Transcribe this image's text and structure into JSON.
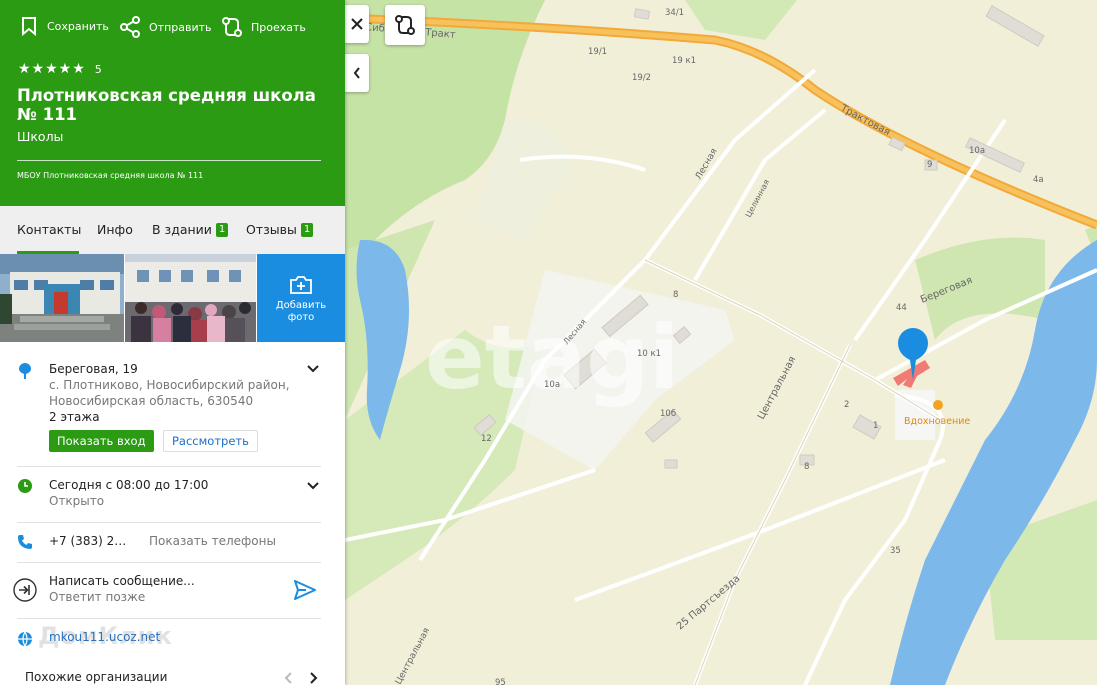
{
  "header": {
    "actions": {
      "save": "Сохранить",
      "share": "Отправить",
      "route": "Проехать"
    },
    "stars_glyphs": "★★★★★",
    "rating": "5",
    "title": "Плотниковская средняя школа № 111",
    "category": "Школы",
    "legal_name": "МБОУ Плотниковская средняя школа № 111",
    "accent_color": "#2b9b14"
  },
  "tabs": [
    {
      "label": "Контакты",
      "active": true
    },
    {
      "label": "Инфо"
    },
    {
      "label": "В здании",
      "badge": "1"
    },
    {
      "label": "Отзывы",
      "badge": "1"
    }
  ],
  "photos": {
    "add_label_1": "Добавить",
    "add_label_2": "фото"
  },
  "address": {
    "street": "Береговая, 19",
    "line2": "с. Плотниково, Новосибирский район,",
    "line3": "Новосибирская область, 630540",
    "floors": "2 этажа",
    "show_entrance": "Показать вход",
    "view": "Рассмотреть"
  },
  "hours": {
    "schedule": "Сегодня с 08:00 до 17:00",
    "status": "Открыто"
  },
  "phone": {
    "number": "+7 (383) 2…",
    "show": "Показать телефоны"
  },
  "message": {
    "label": "Написать сообщение...",
    "sub": "Ответит позже"
  },
  "website": {
    "url": "mkou111.ucoz.net",
    "watermark": "ДомКлик"
  },
  "similar": {
    "label": "Похожие организации"
  },
  "map": {
    "watermark": "etagi",
    "labels": {
      "sibtrakt": "Сибирский Тракт",
      "traktovaya": "Трактовая",
      "lesnaya1": "Лесная",
      "lesnaya2": "Лесная",
      "tselinnaya": "Целинная",
      "beregovaya": "Береговая",
      "tsentralnaya": "Центральная",
      "tsentralnaya2": "Центральная",
      "partsezda": "25 Партсъезда",
      "poi": "Вдохновение"
    },
    "house_numbers": [
      "34/1",
      "19/1",
      "19/2",
      "19 к1",
      "9",
      "10а",
      "4а",
      "8",
      "44",
      "10 к1",
      "10а",
      "10б",
      "12",
      "2",
      "1",
      "8",
      "35",
      "95"
    ]
  }
}
